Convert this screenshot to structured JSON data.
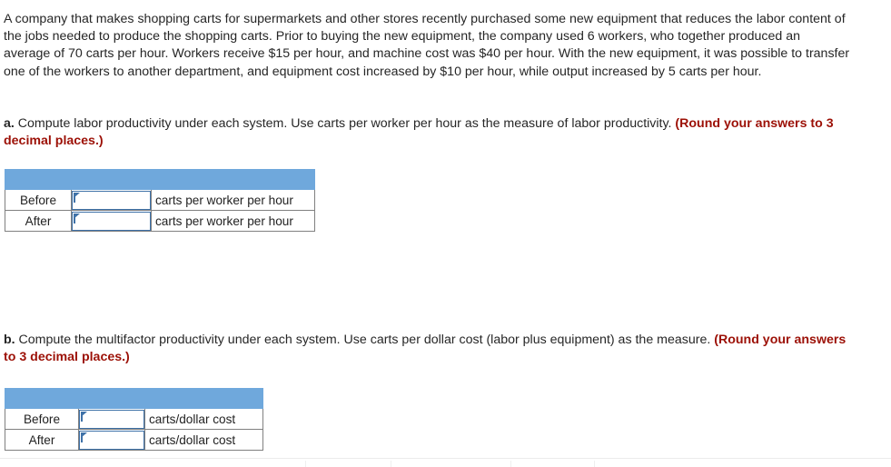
{
  "problem": {
    "statement": "A company that makes shopping carts for supermarkets and other stores recently purchased some new equipment that reduces the labor content of the jobs needed to produce the shopping carts. Prior to buying the new equipment, the company used 6 workers, who together produced an average of 70 carts per hour. Workers receive $15 per hour, and machine cost was $40 per hour. With the new equipment, it was possible to transfer one of the workers to another department, and equipment cost increased by $10 per hour, while output increased by 5 carts per hour."
  },
  "questions": {
    "a": {
      "letter": "a.",
      "text": " Compute labor productivity under each system. Use carts per worker per hour as the measure of labor productivity. ",
      "round_note": "(Round your answers to 3 decimal places.)"
    },
    "b": {
      "letter": "b.",
      "text": " Compute the multifactor productivity under each system. Use carts per dollar cost (labor plus equipment) as the measure. ",
      "round_note": "(Round your answers to 3 decimal places.)"
    }
  },
  "table_a": {
    "header_label": "",
    "rows": [
      {
        "label": "Before",
        "value": "",
        "placeholder": "",
        "unit": "carts per worker per hour"
      },
      {
        "label": "After",
        "value": "",
        "placeholder": "",
        "unit": "carts per worker per hour"
      }
    ]
  },
  "table_b": {
    "header_label": "",
    "rows": [
      {
        "label": "Before",
        "value": "",
        "placeholder": "",
        "unit": "carts/dollar cost"
      },
      {
        "label": "After",
        "value": "",
        "placeholder": "",
        "unit": "carts/dollar cost"
      }
    ]
  },
  "colors": {
    "header_blue": "#6fa8dc",
    "input_border_blue": "#3f72a8",
    "round_note_red": "#9c1006",
    "body_text": "#262626",
    "table_border": "#808080"
  }
}
